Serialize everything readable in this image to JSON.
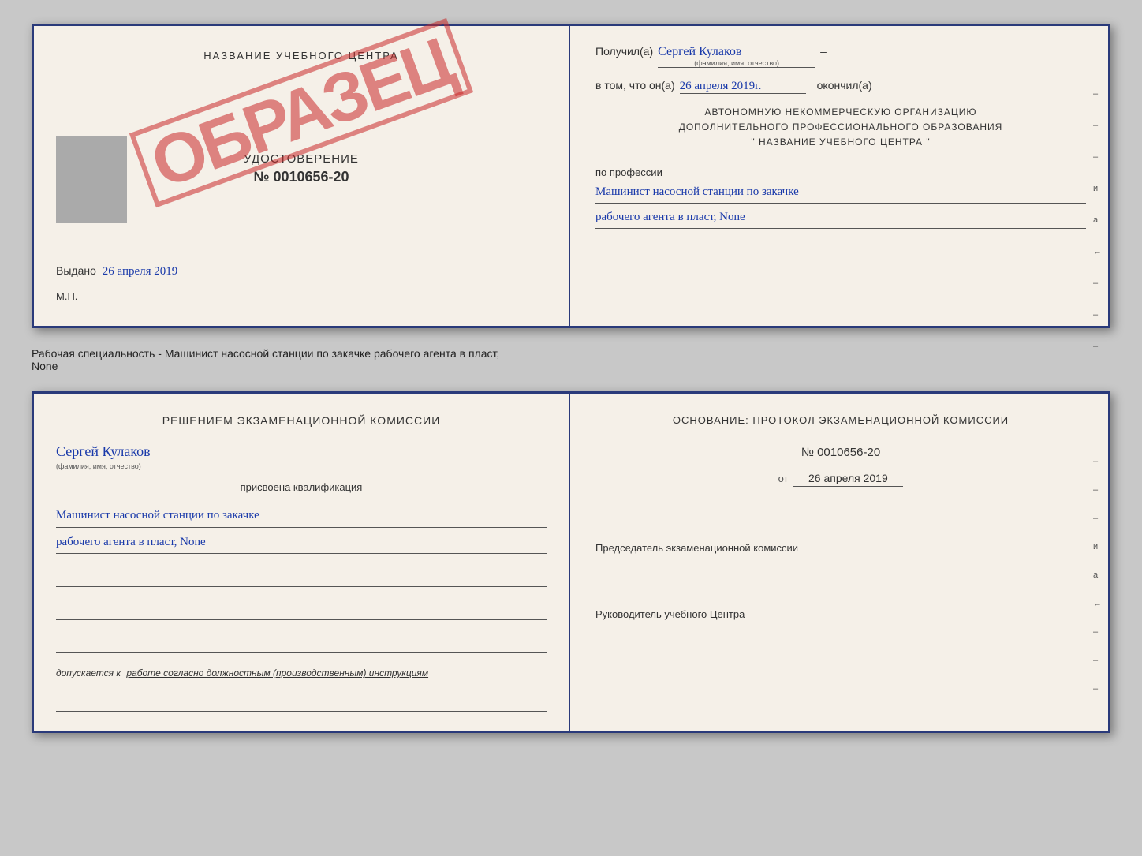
{
  "top_spread": {
    "left": {
      "training_center": "НАЗВАНИЕ УЧЕБНОГО ЦЕНТРА",
      "stamp": "ОБРАЗЕЦ",
      "udost_title": "УДОСТОВЕРЕНИЕ",
      "udost_number": "№ 0010656-20",
      "vydano_label": "Выдано",
      "vydano_date": "26 апреля 2019",
      "mp_label": "М.П."
    },
    "right": {
      "poluchil_label": "Получил(a)",
      "recipient_name": "Сергей Кулаков",
      "name_hint": "(фамилия, имя, отчество)",
      "vtom_label": "в том, что он(а)",
      "date_value": "26 апреля 2019г.",
      "okonchil_label": "окончил(а)",
      "org_line1": "АВТОНОМНУЮ НЕКОММЕРЧЕСКУЮ ОРГАНИЗАЦИЮ",
      "org_line2": "ДОПОЛНИТЕЛЬНОГО ПРОФЕССИОНАЛЬНОГО ОБРАЗОВАНИЯ",
      "org_line3": "\"  НАЗВАНИЕ УЧЕБНОГО ЦЕНТРА  \"",
      "profession_label": "по профессии",
      "profession_line1": "Машинист насосной станции по закачке",
      "profession_line2": "рабочего агента в пласт, None",
      "side_marks": [
        "-",
        "-",
        "-",
        "и",
        "а",
        "←",
        "-",
        "-",
        "-"
      ]
    }
  },
  "subtitle": "Рабочая специальность - Машинист насосной станции по закачке рабочего агента в пласт,\nNone",
  "bottom_spread": {
    "left": {
      "commission_title": "Решением экзаменационной комиссии",
      "name_value": "Сергей Кулаков",
      "name_hint": "(фамилия, имя, отчество)",
      "assigned_label": "присвоена квалификация",
      "qualification_line1": "Машинист насосной станции по закачке",
      "qualification_line2": "рабочего агента в пласт, None",
      "blank_lines": [
        "",
        "",
        ""
      ],
      "dopuskaetsya_prefix": "допускается к",
      "dopuskaetsya_link": "работе согласно должностным (производственным) инструкциям",
      "blank_line2": ""
    },
    "right": {
      "osnov_label": "Основание: протокол экзаменационной комиссии",
      "protocol_number": "№ 0010656-20",
      "ot_label": "от",
      "ot_date": "26 апреля 2019",
      "predsedatel_label": "Председатель экзаменационной комиссии",
      "rukovoditel_label": "Руководитель учебного Центра",
      "side_marks": [
        "-",
        "-",
        "-",
        "и",
        "а",
        "←",
        "-",
        "-",
        "-"
      ]
    }
  }
}
